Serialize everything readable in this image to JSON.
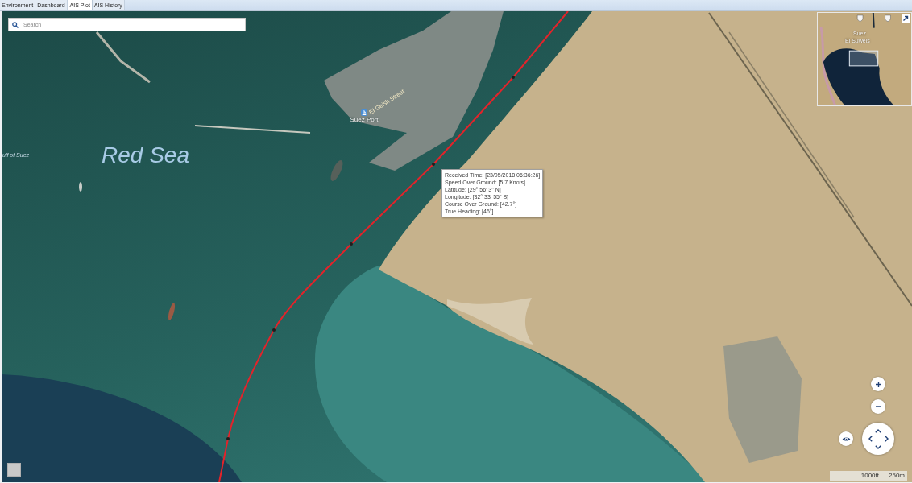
{
  "tabs": [
    {
      "label": "Environment",
      "selected": false
    },
    {
      "label": "Dashboard",
      "selected": false
    },
    {
      "label": "AIS Plot",
      "selected": true
    },
    {
      "label": "AIS History",
      "selected": false
    }
  ],
  "search": {
    "placeholder": "Search"
  },
  "map_labels": [
    {
      "text": "Red Sea",
      "kind": "sea"
    },
    {
      "text": "ulf of Suez",
      "kind": "region"
    },
    {
      "text": "El Geish Street",
      "kind": "street"
    },
    {
      "text": "Suez Port",
      "kind": "poi"
    }
  ],
  "tooltip": {
    "lines": [
      "Received Time: [23/05/2018 06:36:26]",
      "Speed Over Ground: [5.7 Knots]",
      "Latitude: [29° 56' 3\" N]",
      "Longitude: [32° 33' 55\" S]",
      "Course Over Ground: [42.7°]",
      "True Heading: [46°]"
    ]
  },
  "minimap": {
    "labels": [
      "Suez",
      "El Suweis"
    ]
  },
  "scale_bar": {
    "labels": [
      "1000ft",
      "250m"
    ]
  }
}
